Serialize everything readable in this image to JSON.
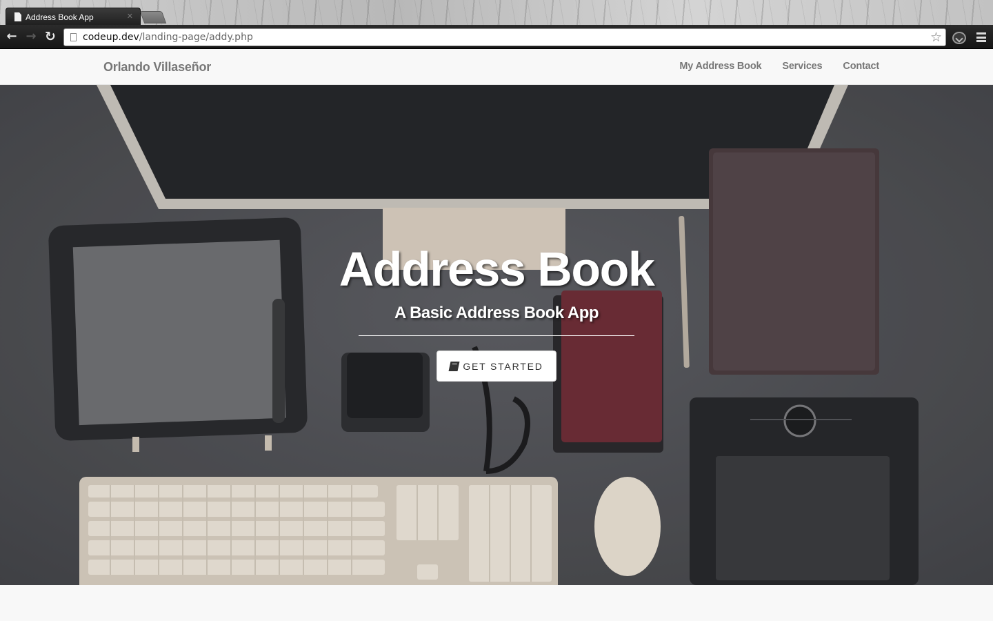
{
  "browser": {
    "tab_title": "Address Book App",
    "url_host": "codeup.dev",
    "url_path": "/landing-page/addy.php",
    "icons": [
      "back-arrow-icon",
      "forward-arrow-icon",
      "reload-icon",
      "page-icon",
      "star-icon",
      "extension-icon",
      "menu-icon"
    ]
  },
  "navbar": {
    "brand": "Orlando Villaseñor",
    "links": [
      "My Address Book",
      "Services",
      "Contact"
    ]
  },
  "hero": {
    "title": "Address Book",
    "subtitle": "A Basic Address Book App",
    "cta_label": "GET STARTED",
    "cta_icon": "book-icon"
  },
  "colors": {
    "navbar_bg": "#f8f8f8",
    "navbar_text": "#777777",
    "hero_text": "#ffffff",
    "button_bg": "#ffffff"
  }
}
